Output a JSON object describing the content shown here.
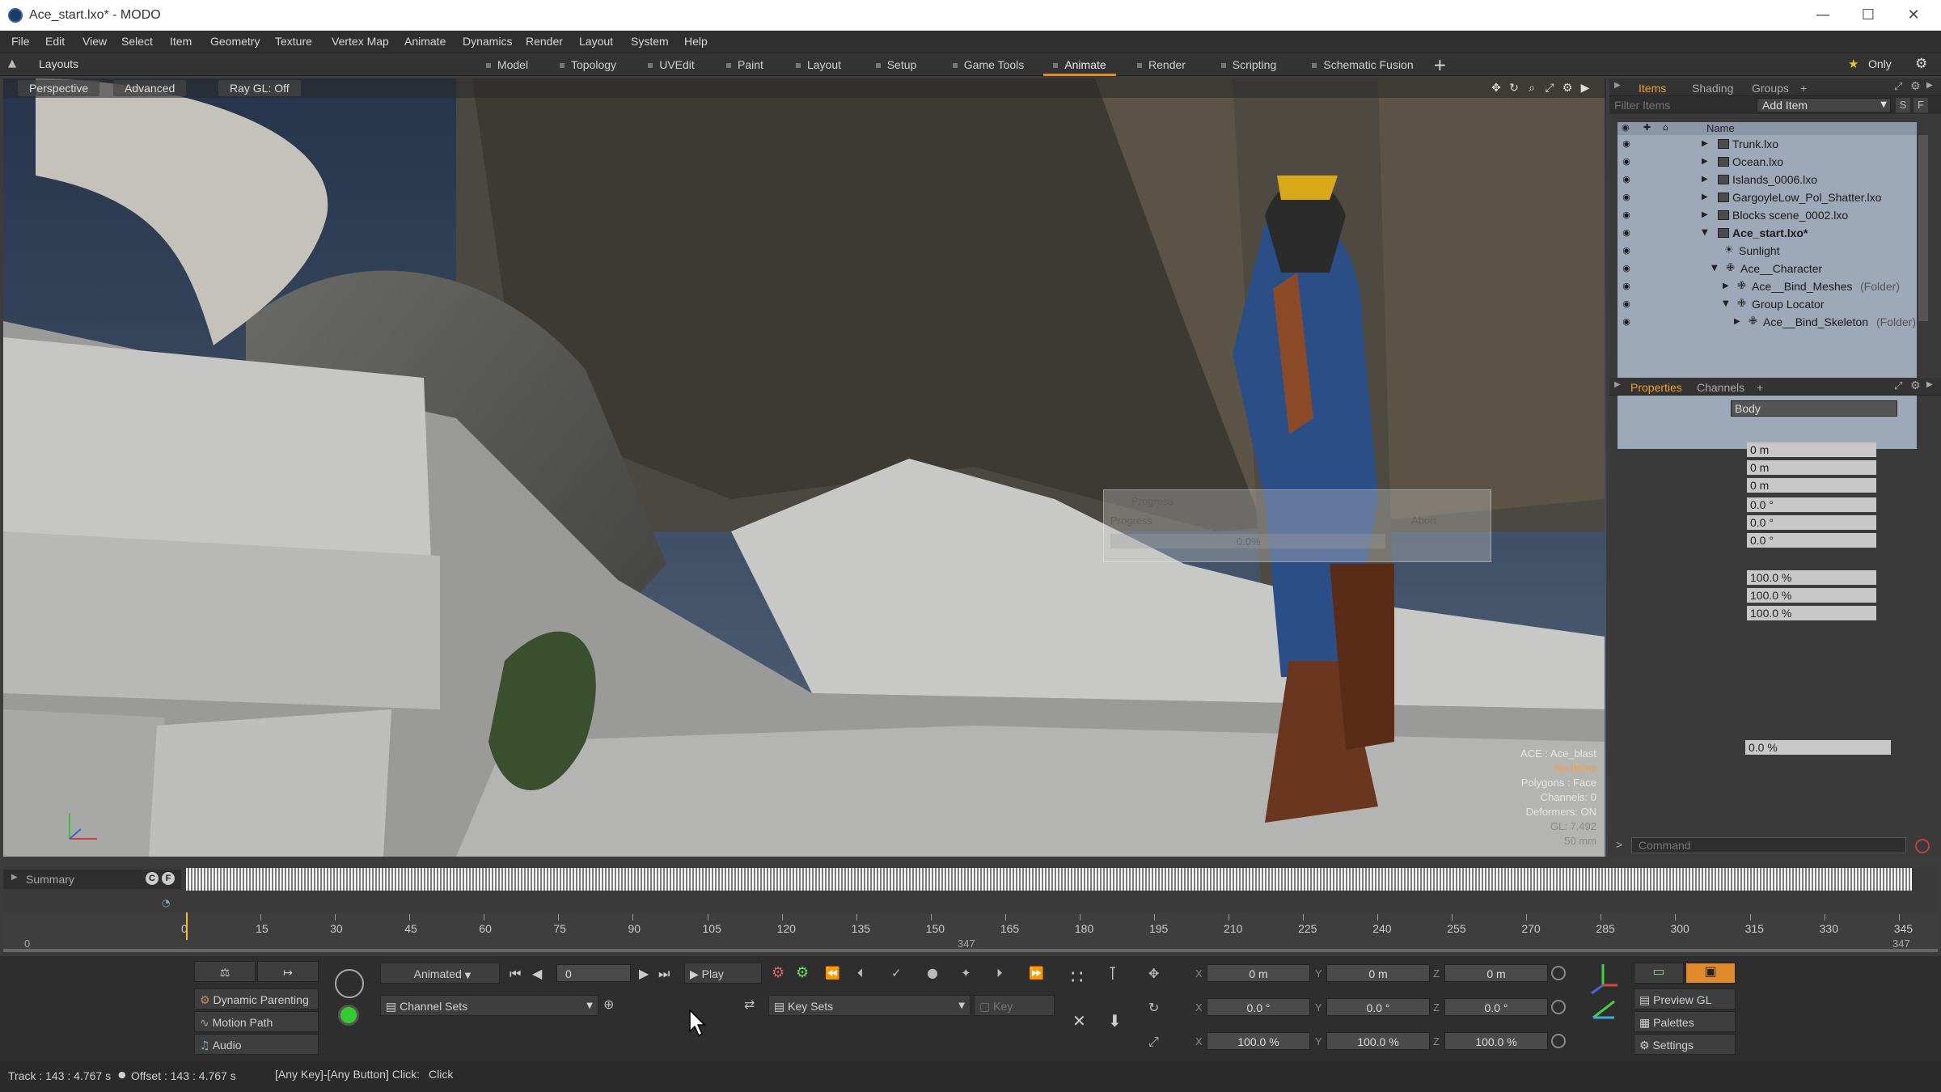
{
  "window": {
    "title": "Ace_start.lxo* - MODO",
    "min": "—",
    "max": "☐",
    "close": "✕"
  },
  "menu": [
    "File",
    "Edit",
    "View",
    "Select",
    "Item",
    "Geometry",
    "Texture",
    "Vertex Map",
    "Animate",
    "Dynamics",
    "Render",
    "Layout",
    "System",
    "Help"
  ],
  "layouts_label": "Layouts",
  "layout_tabs": [
    "Model",
    "Topology",
    "UVEdit",
    "Paint",
    "Layout",
    "Setup",
    "Game Tools",
    "Animate",
    "Render",
    "Scripting",
    "Schematic Fusion"
  ],
  "active_layout_tab": "Animate",
  "add_tab": "+",
  "only_label": "Only",
  "viewport": {
    "perspective": "Perspective",
    "advanced": "Advanced",
    "raygl": "Ray GL: Off",
    "hud": {
      "item": "ACE : Ace_blast",
      "selection": "No Items",
      "polygons": "Polygons : Face",
      "channels": "Channels: 0",
      "deformers": "Deformers: ON",
      "gl": "GL: 7,492",
      "focal": "50 mm"
    },
    "progress_title": "Progress",
    "progress_label": "Progress",
    "progress_pct": "0.0%",
    "progress_abort": "Abort"
  },
  "items_panel": {
    "tabs": [
      "Items",
      "Shading",
      "Groups"
    ],
    "filter_placeholder": "Filter Items",
    "add_item": "Add Item",
    "s_btn": "S",
    "f_btn": "F",
    "name_header": "Name",
    "rows": [
      {
        "label": "Trunk.lxo"
      },
      {
        "label": "Ocean.lxo"
      },
      {
        "label": "Islands_0006.lxo"
      },
      {
        "label": "GargoyleLow_Pol_Shatter.lxo"
      },
      {
        "label": "Blocks scene_0002.lxo"
      },
      {
        "label": "Ace_start.lxo*"
      },
      {
        "label": "Sunlight"
      },
      {
        "label": "Ace__Character"
      },
      {
        "label": "Ace__Bind_Meshes",
        "suffix": "(Folder)"
      },
      {
        "label": "Group Locator"
      },
      {
        "label": "Ace__Bind_Skeleton",
        "suffix": "(Folder)"
      }
    ]
  },
  "properties_panel": {
    "tabs": [
      "Properties",
      "Channels"
    ],
    "add": "+",
    "name_value": "Body",
    "position": [
      "0 m",
      "0 m",
      "0 m"
    ],
    "rotation": [
      "0.0 °",
      "0.0 °",
      "0.0 °"
    ],
    "scale": [
      "100.0 %",
      "100.0 %",
      "100.0 %"
    ],
    "extra": "0.0 %",
    "command_placeholder": "Command",
    "command_prompt": ">"
  },
  "timeline": {
    "summary": "Summary",
    "c_btn": "C",
    "f_btn": "F",
    "ruler_ticks": [
      "0",
      "15",
      "30",
      "45",
      "60",
      "75",
      "90",
      "105",
      "120",
      "135",
      "150",
      "165",
      "180",
      "195",
      "210",
      "225",
      "240",
      "255",
      "270",
      "285",
      "300",
      "315",
      "330",
      "345"
    ],
    "range_start": "0",
    "range_mid": "347",
    "range_end": "347"
  },
  "controls": {
    "dynamic_parenting": "Dynamic Parenting",
    "motion_path": "Motion Path",
    "audio": "Audio",
    "mode": "Animated",
    "frame": "0",
    "play": "Play",
    "channel_sets": "Channel Sets",
    "key_sets": "Key Sets",
    "key": "Key",
    "xyz": [
      "X",
      "Y",
      "Z"
    ],
    "pos": [
      "0 m",
      "0 m",
      "0 m"
    ],
    "rot": [
      "0.0 °",
      "0.0 °",
      "0.0 °"
    ],
    "scl": [
      "100.0 %",
      "100.0 %",
      "100.0 %"
    ],
    "preview_gl": "Preview GL",
    "palettes": "Palettes",
    "settings": "Settings"
  },
  "status": {
    "track": "Track : 143 : 4.767 s",
    "offset": "Offset : 143 : 4.767 s",
    "hint": "[Any Key]-[Any Button] Click:",
    "hint_action": "Click"
  },
  "colors": {
    "accent": "#e08a2a",
    "list_bg": "#9da8b8",
    "hud_orange": "#ff9b3a"
  }
}
